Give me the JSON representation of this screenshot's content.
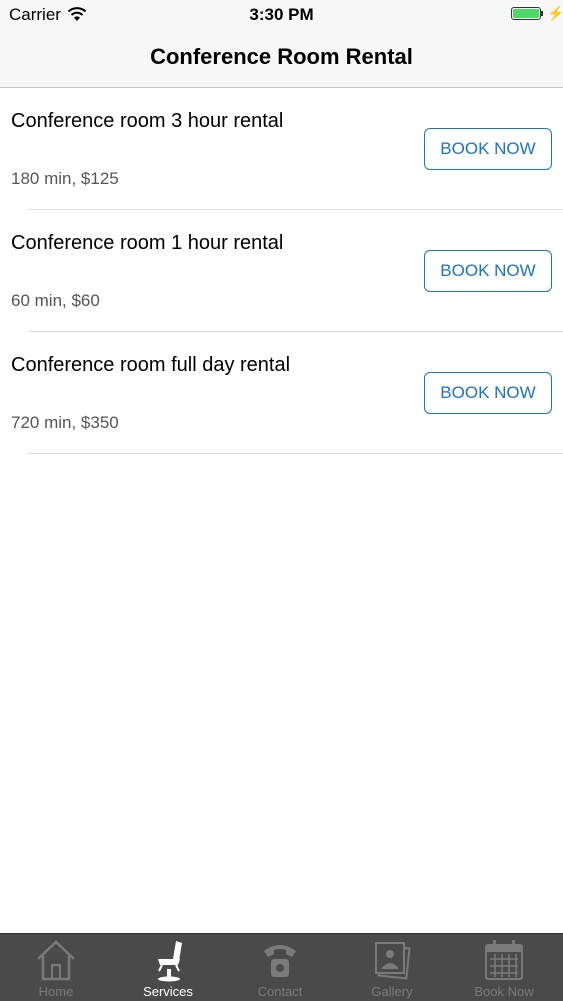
{
  "status_bar": {
    "carrier": "Carrier",
    "time": "3:30 PM",
    "battery_color": "#4cd964",
    "charge_symbol": "⚡"
  },
  "nav": {
    "title": "Conference Room Rental"
  },
  "services": [
    {
      "title": "Conference room 3 hour rental",
      "subtitle": "180 min, $125",
      "button": "BOOK NOW"
    },
    {
      "title": "Conference room 1 hour rental",
      "subtitle": "60 min, $60",
      "button": "BOOK NOW"
    },
    {
      "title": "Conference room full day rental",
      "subtitle": "720 min, $350",
      "button": "BOOK NOW"
    }
  ],
  "tabs": [
    {
      "label": "Home",
      "icon": "house-icon",
      "active": false
    },
    {
      "label": "Services",
      "icon": "salon-chair-icon",
      "active": true
    },
    {
      "label": "Contact",
      "icon": "phone-icon",
      "active": false
    },
    {
      "label": "Gallery",
      "icon": "photos-icon",
      "active": false
    },
    {
      "label": "Book Now",
      "icon": "calendar-icon",
      "active": false
    }
  ],
  "colors": {
    "accent": "#1a73c9",
    "tab_bar": "#4a4a4a"
  }
}
